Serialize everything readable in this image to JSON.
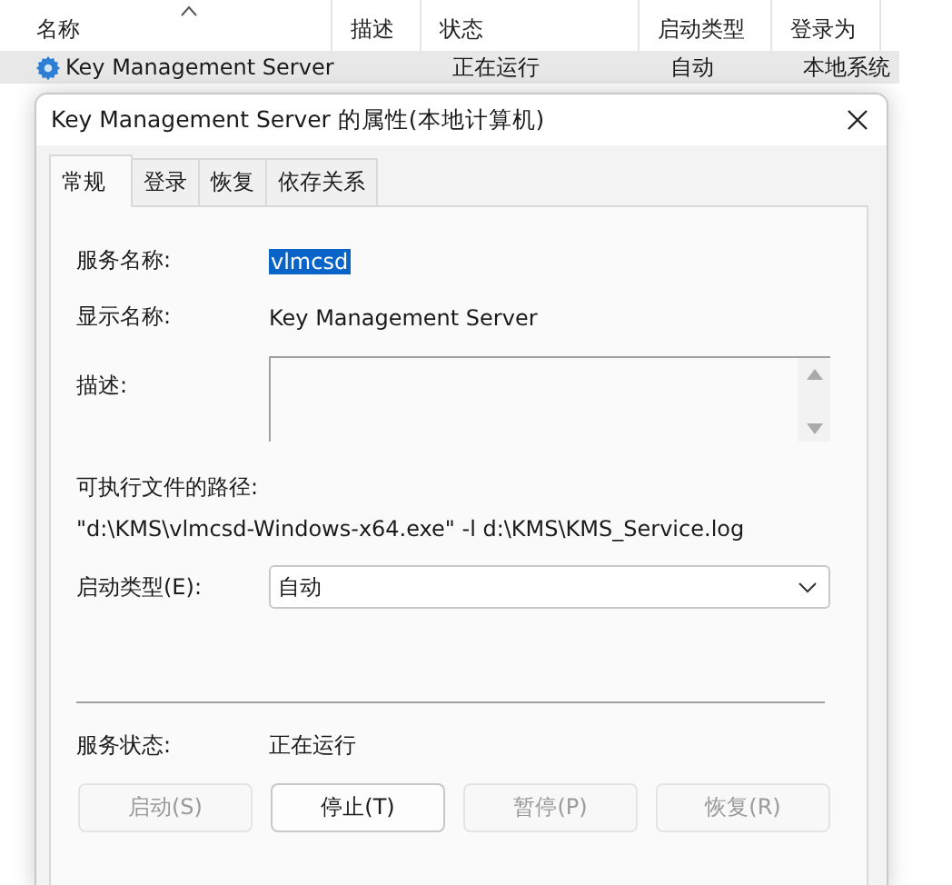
{
  "services_list": {
    "columns": [
      {
        "label": "名称",
        "sorted": true
      },
      {
        "label": "描述",
        "sorted": false
      },
      {
        "label": "状态",
        "sorted": false
      },
      {
        "label": "启动类型",
        "sorted": false
      },
      {
        "label": "登录为",
        "sorted": false
      }
    ],
    "rows": [
      {
        "cells": [
          "Key Management Server",
          "",
          "正在运行",
          "自动",
          "本地系统"
        ],
        "selected": true
      }
    ]
  },
  "dialog": {
    "title": "Key Management Server 的属性(本地计算机)",
    "tabs": [
      {
        "label": "常规",
        "selected": true
      },
      {
        "label": "登录",
        "selected": false
      },
      {
        "label": "恢复",
        "selected": false
      },
      {
        "label": "依存关系",
        "selected": false
      }
    ],
    "service_name": {
      "label": "服务名称:",
      "value": "vlmcsd"
    },
    "display_name": {
      "label": "显示名称:",
      "value": "Key Management Server"
    },
    "description": {
      "label": "描述:"
    },
    "path": {
      "label": "可执行文件的路径:",
      "value": "\"d:\\KMS\\vlmcsd-Windows-x64.exe\" -l d:\\KMS\\KMS_Service.log"
    },
    "startup_type": {
      "label": "启动类型(E):",
      "value": "自动"
    },
    "service_status": {
      "label": "服务状态:",
      "value": "正在运行"
    },
    "buttons": [
      {
        "label": "启动(S)",
        "disabled": true
      },
      {
        "label": "停止(T)",
        "disabled": false
      },
      {
        "label": "暂停(P)",
        "disabled": true
      },
      {
        "label": "恢复(R)",
        "disabled": true
      }
    ]
  }
}
